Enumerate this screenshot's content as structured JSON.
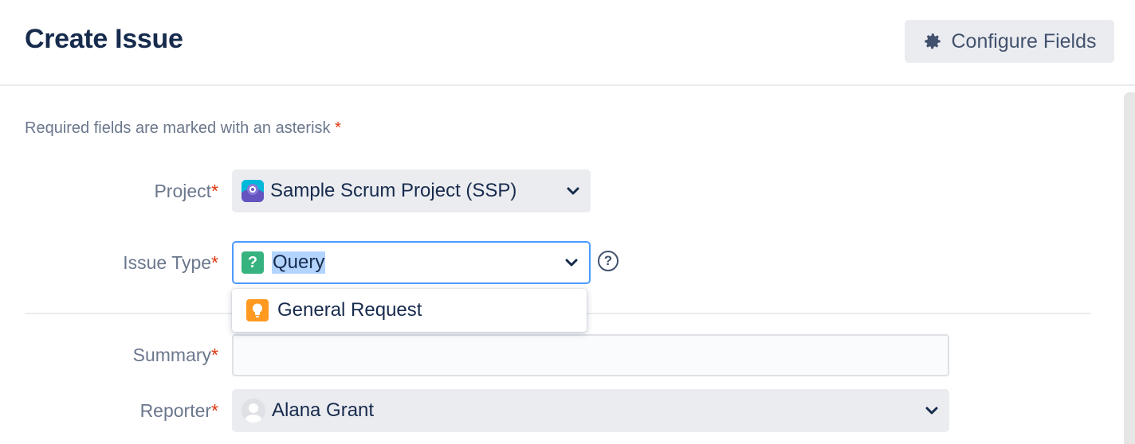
{
  "header": {
    "title": "Create Issue",
    "configure_label": "Configure Fields"
  },
  "form": {
    "required_note": "Required fields are marked with an asterisk",
    "required_marker": "*",
    "project": {
      "label": "Project",
      "value": "Sample Scrum Project (SSP)"
    },
    "issue_type": {
      "label": "Issue Type",
      "value": "Query",
      "dropdown_option": "General Request"
    },
    "summary": {
      "label": "Summary",
      "value": ""
    },
    "reporter": {
      "label": "Reporter",
      "value": "Alana Grant"
    }
  },
  "icons": {
    "configure": "gear-icon",
    "project": "project-avatar-icon",
    "issue_type": "question-icon",
    "help": "help-icon",
    "option": "lightbulb-icon",
    "reporter": "user-avatar-icon",
    "chevron": "chevron-down-icon"
  },
  "colors": {
    "accent": "#4c9aff",
    "required": "#de350b",
    "query_icon": "#36b37e",
    "request_icon": "#ff991f",
    "selection": "#b3d4ff"
  }
}
